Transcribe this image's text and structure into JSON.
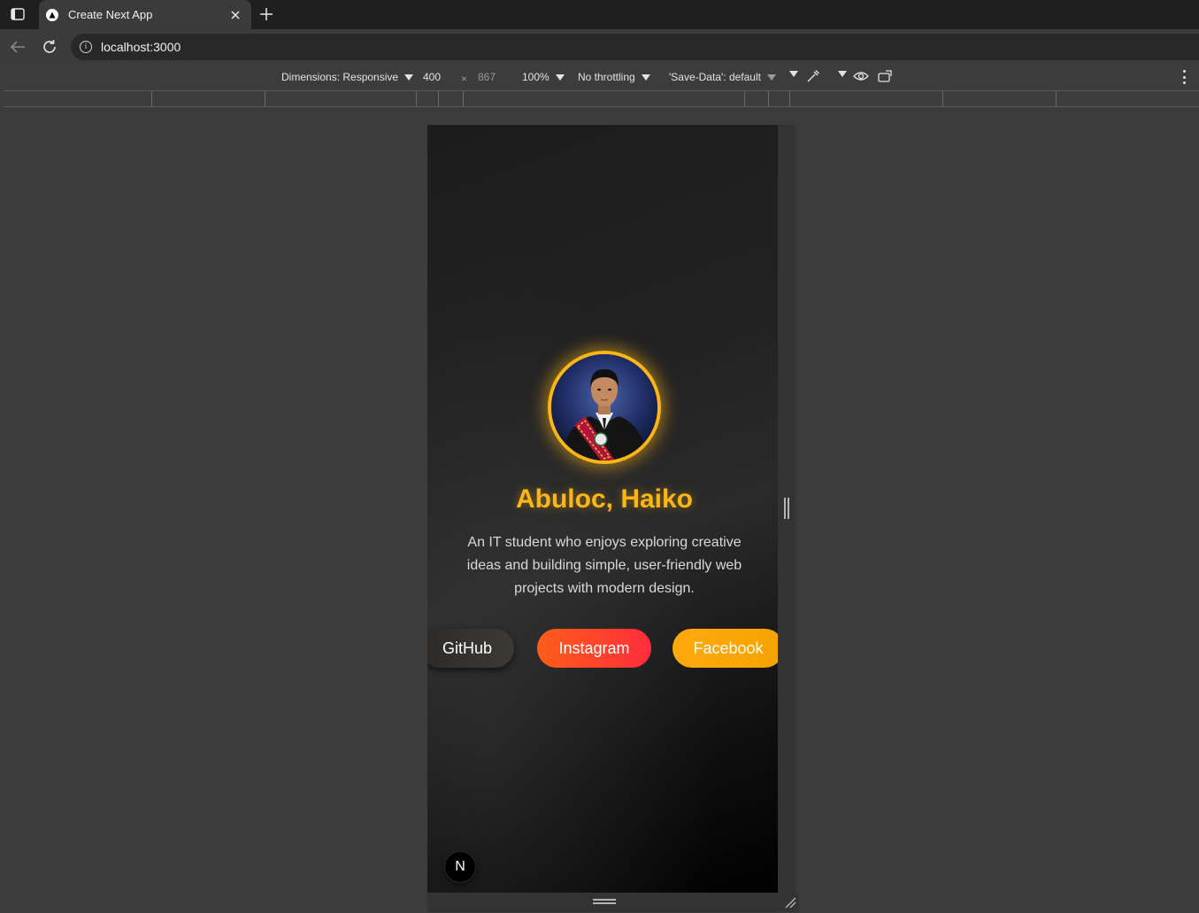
{
  "browser": {
    "tab_title": "Create Next App",
    "url": "localhost:3000"
  },
  "devtools": {
    "dimensions_label": "Dimensions: Responsive",
    "width_value": "400",
    "times_sign": "×",
    "height_value": "867",
    "zoom": "100%",
    "throttling": "No throttling",
    "save_data": "'Save-Data': default"
  },
  "profile": {
    "name": "Abuloc, Haiko",
    "bio": "An IT student who enjoys exploring creative ideas and building simple, user-friendly web projects with modern design.",
    "buttons": {
      "github": "GitHub",
      "instagram": "Instagram",
      "facebook": "Facebook"
    },
    "accent_color": "#fbb515"
  },
  "next_badge": "N"
}
